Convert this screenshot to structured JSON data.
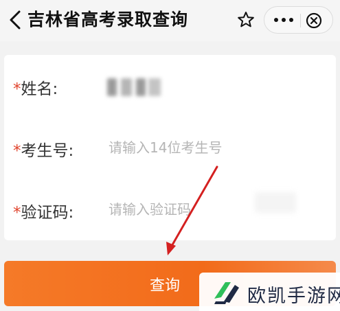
{
  "header": {
    "title": "吉林省高考录取查询"
  },
  "form": {
    "name_field": {
      "required_mark": "*",
      "label": "姓名:"
    },
    "exam_number_field": {
      "required_mark": "*",
      "label": "考生号:",
      "placeholder": "请输入14位考生号"
    },
    "captcha_field": {
      "required_mark": "*",
      "label": "验证码:",
      "placeholder": "请输入验证码"
    }
  },
  "submit_button": {
    "label": "查询"
  },
  "watermark": {
    "text": "欧凯手游网"
  },
  "colors": {
    "accent": "#f26b1a",
    "required": "#e0432c",
    "annotation_arrow": "#d42020",
    "watermark_green": "#2fbf5a"
  },
  "icons": [
    "back-icon",
    "star-icon",
    "more-icon",
    "close-icon",
    "watermark-logo-icon",
    "annotation-arrow"
  ]
}
